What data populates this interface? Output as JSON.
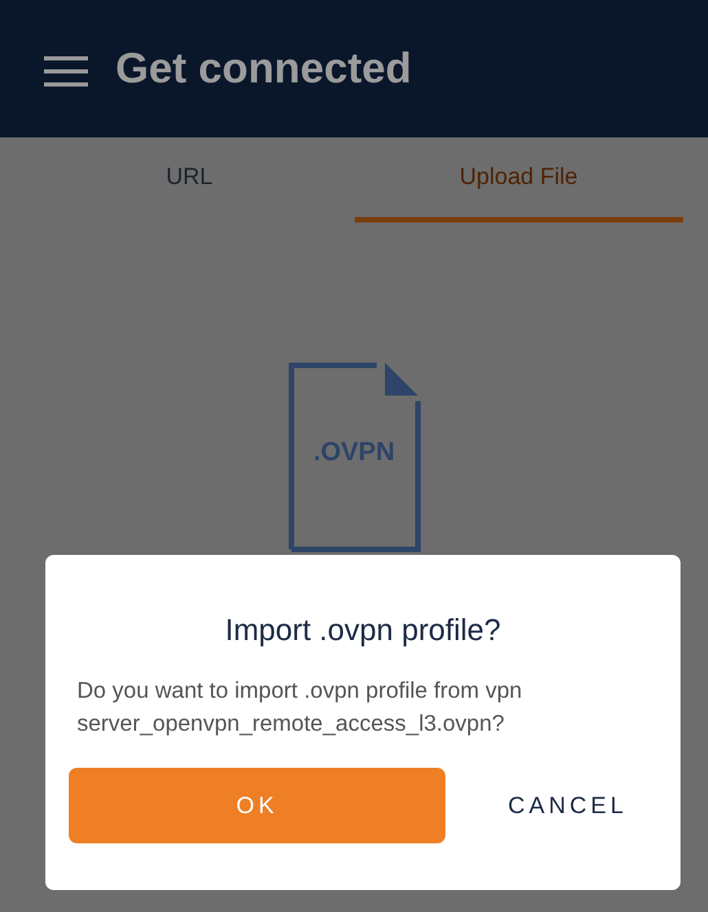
{
  "header": {
    "title": "Get connected"
  },
  "tabs": [
    {
      "label": "URL",
      "selected": false
    },
    {
      "label": "Upload File",
      "selected": true
    }
  ],
  "file_icon": {
    "label": ".OVPN"
  },
  "dialog": {
    "title": "Import .ovpn profile?",
    "message": "Do you want to import .ovpn profile from vpn server_openvpn_remote_access_l3.ovpn?",
    "buttons": [
      {
        "label": "OK",
        "kind": "primary"
      },
      {
        "label": "CANCEL",
        "kind": "text"
      }
    ]
  }
}
